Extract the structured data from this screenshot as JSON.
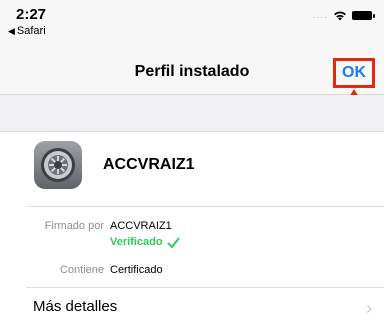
{
  "status_bar": {
    "time": "2:27",
    "back_app": "Safari",
    "signal": "....",
    "wifi_icon": "wifi-icon",
    "battery_icon": "battery-icon"
  },
  "nav": {
    "title": "Perfil instalado",
    "ok_label": "OK"
  },
  "annotation": {
    "highlight_color": "#e02a10",
    "arrow_icon": "red-arrow-up-icon"
  },
  "profile": {
    "icon": "settings-gear-icon",
    "name": "ACCVRAIZ1",
    "signed_by_label": "Firmado por",
    "signed_by_value": "ACCVRAIZ1",
    "verified_label": "Verificado",
    "verified_icon": "checkmark-icon",
    "contains_label": "Contiene",
    "contains_value": "Certificado",
    "more_details_label": "Más detalles",
    "chevron_icon": "chevron-right-icon"
  },
  "colors": {
    "accent_blue": "#1a7cf5",
    "verified_green": "#34c759",
    "annotation_red": "#e02a10"
  }
}
